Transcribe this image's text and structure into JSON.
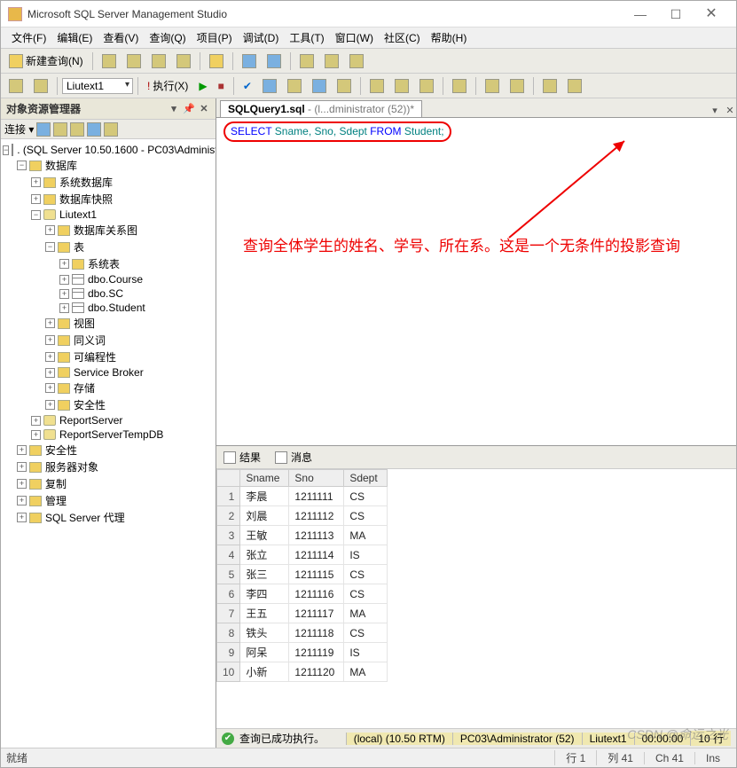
{
  "window": {
    "title": "Microsoft SQL Server Management Studio"
  },
  "menu": [
    "文件(F)",
    "编辑(E)",
    "查看(V)",
    "查询(Q)",
    "项目(P)",
    "调试(D)",
    "工具(T)",
    "窗口(W)",
    "社区(C)",
    "帮助(H)"
  ],
  "toolbar1": {
    "newQuery": "新建查询(N)"
  },
  "toolbar2": {
    "dbCombo": "Liutext1",
    "execute": "执行(X)"
  },
  "explorer": {
    "title": "对象资源管理器",
    "connLabel": "连接 ▾",
    "root": ". (SQL Server 10.50.1600 - PC03\\Administ",
    "nodes": {
      "databases": "数据库",
      "sysdb": "系统数据库",
      "snapshots": "数据库快照",
      "liutext": "Liutext1",
      "diagrams": "数据库关系图",
      "tables": "表",
      "systables": "系统表",
      "course": "dbo.Course",
      "sc": "dbo.SC",
      "student": "dbo.Student",
      "views": "视图",
      "synonyms": "同义词",
      "programmability": "可编程性",
      "sbroker": "Service Broker",
      "storage": "存储",
      "security_db": "安全性",
      "report": "ReportServer",
      "reporttmp": "ReportServerTempDB",
      "security": "安全性",
      "serverobj": "服务器对象",
      "replication": "复制",
      "management": "管理",
      "agent": "SQL Server 代理"
    }
  },
  "tab": {
    "name": "SQLQuery1.sql",
    "detail": " - (l...dministrator (52))*"
  },
  "sql": {
    "select": "SELECT",
    "cols": " Sname, Sno, Sdept  ",
    "from": "FROM",
    "tbl": "  Student;"
  },
  "annotation": "查询全体学生的姓名、学号、所在系。这是一个无条件的投影查询",
  "results": {
    "tabResults": "结果",
    "tabMessages": "消息",
    "columns": [
      "Sname",
      "Sno",
      "Sdept"
    ],
    "rows": [
      [
        "李晨",
        "1211111",
        "CS"
      ],
      [
        "刘晨",
        "1211112",
        "CS"
      ],
      [
        "王敏",
        "1211113",
        "MA"
      ],
      [
        "张立",
        "1211114",
        "IS"
      ],
      [
        "张三",
        "1211115",
        "CS"
      ],
      [
        "李四",
        "1211116",
        "CS"
      ],
      [
        "王五",
        "1211117",
        "MA"
      ],
      [
        "铁头",
        "1211118",
        "CS"
      ],
      [
        "阿呆",
        "1211119",
        "IS"
      ],
      [
        "小新",
        "1211120",
        "MA"
      ]
    ]
  },
  "execStatus": {
    "msg": "查询已成功执行。",
    "server": "(local) (10.50 RTM)",
    "user": "PC03\\Administrator (52)",
    "db": "Liutext1",
    "time": "00:00:00",
    "rows": "10 行"
  },
  "status": {
    "ready": "就绪",
    "line": "行 1",
    "col": "列 41",
    "ch": "Ch 41",
    "ins": "Ins"
  },
  "watermark": "CSDN @命运之光"
}
